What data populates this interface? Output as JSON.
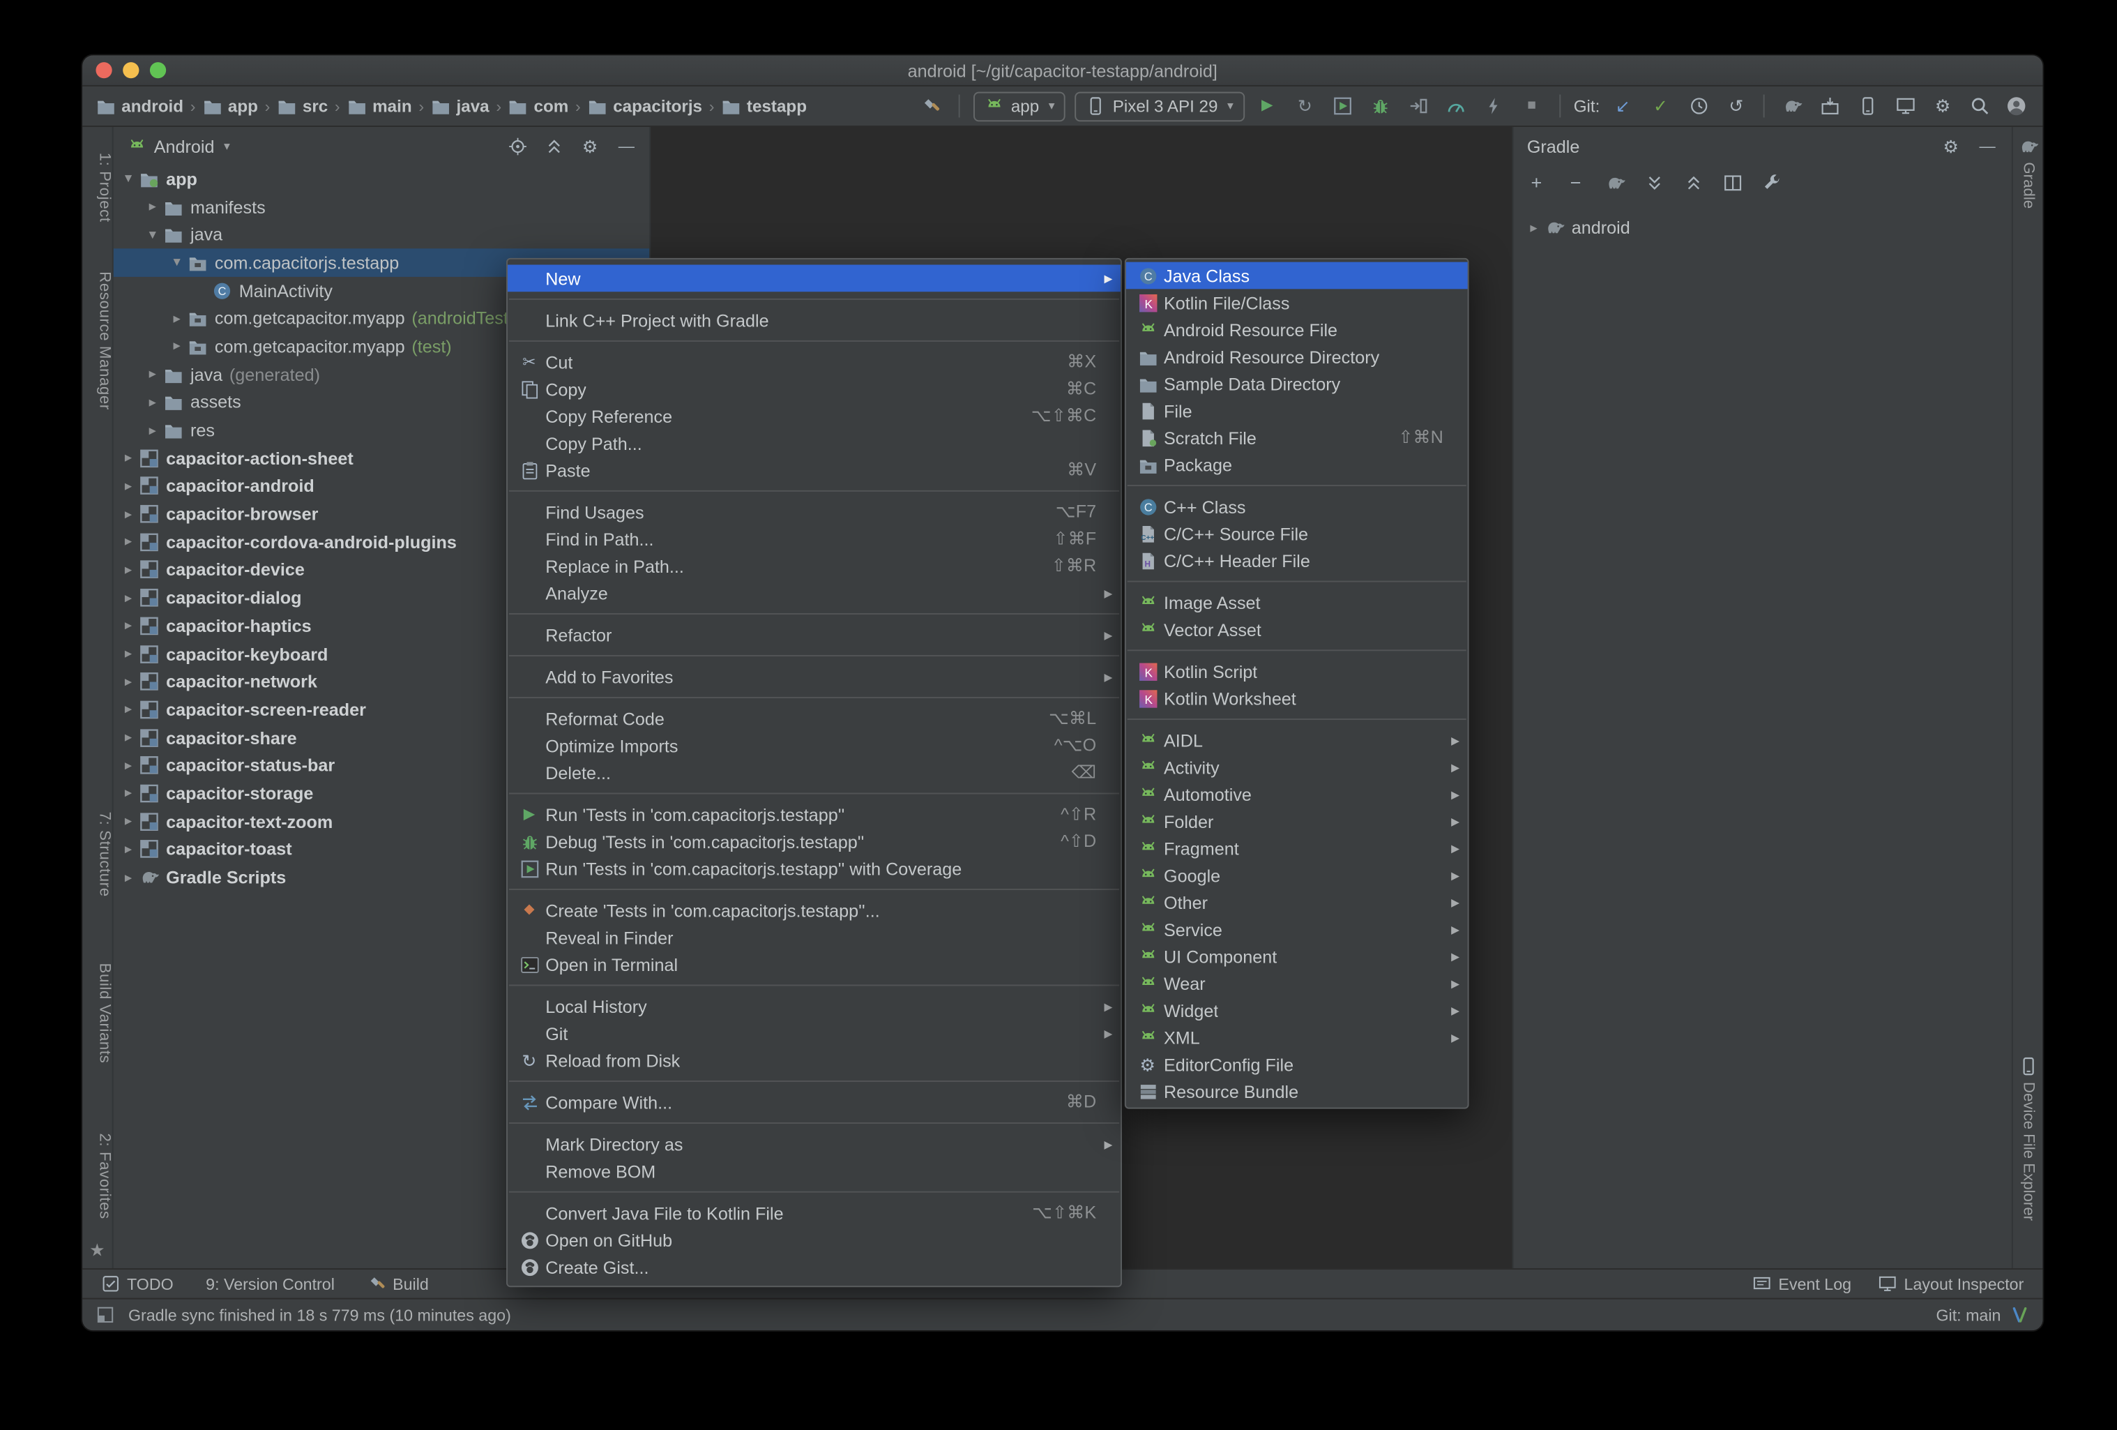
{
  "window": {
    "title": "android [~/git/capacitor-testapp/android]"
  },
  "toolbar": {
    "breadcrumbs": [
      "android",
      "app",
      "src",
      "main",
      "java",
      "com",
      "capacitorjs",
      "testapp"
    ],
    "run_config": "app",
    "device": "Pixel 3 API 29",
    "git_label": "Git:",
    "action_icons": [
      "run",
      "apply-changes",
      "coverage",
      "debug",
      "attach-debugger",
      "profiler",
      "instant-run",
      "stop"
    ],
    "git_icons": [
      "update-project",
      "commit",
      "history",
      "rollback"
    ],
    "tool_icons": [
      "gradle-sync",
      "sdk-manager",
      "avd-manager",
      "layout-inspector",
      "settings"
    ]
  },
  "left_stripe": {
    "items": [
      "1: Project",
      "Resource Manager",
      "7: Structure",
      "Build Variants",
      "2: Favorites"
    ]
  },
  "right_stripe": {
    "top": "Gradle",
    "bottom": "Device File Explorer"
  },
  "project_panel": {
    "view_selector": "Android",
    "header_icons": [
      "locate",
      "collapse-all",
      "settings",
      "hide"
    ],
    "tree": [
      {
        "label": "app",
        "icon": "app-folder",
        "level": 0,
        "chevron": "down",
        "bold": true
      },
      {
        "label": "manifests",
        "icon": "folder",
        "level": 1,
        "chevron": "right"
      },
      {
        "label": "java",
        "icon": "folder",
        "level": 1,
        "chevron": "down"
      },
      {
        "label": "com.capacitorjs.testapp",
        "icon": "package",
        "level": 2,
        "chevron": "down",
        "selected": true
      },
      {
        "label": "MainActivity",
        "icon": "class",
        "level": 3
      },
      {
        "label": "com.getcapacitor.myapp",
        "suffix": "(androidTest)",
        "suffix_type": "test",
        "icon": "package",
        "level": 2,
        "chevron": "right"
      },
      {
        "label": "com.getcapacitor.myapp",
        "suffix": "(test)",
        "suffix_type": "test",
        "icon": "package",
        "level": 2,
        "chevron": "right"
      },
      {
        "label": "java",
        "suffix": "(generated)",
        "suffix_type": "generated",
        "icon": "folder",
        "level": 1,
        "chevron": "right"
      },
      {
        "label": "assets",
        "icon": "folder",
        "level": 1,
        "chevron": "right"
      },
      {
        "label": "res",
        "icon": "folder",
        "level": 1,
        "chevron": "right"
      },
      {
        "label": "capacitor-action-sheet",
        "icon": "module",
        "level": 0,
        "chevron": "right",
        "bold": true
      },
      {
        "label": "capacitor-android",
        "icon": "module",
        "level": 0,
        "chevron": "right",
        "bold": true
      },
      {
        "label": "capacitor-browser",
        "icon": "module",
        "level": 0,
        "chevron": "right",
        "bold": true
      },
      {
        "label": "capacitor-cordova-android-plugins",
        "icon": "module",
        "level": 0,
        "chevron": "right",
        "bold": true
      },
      {
        "label": "capacitor-device",
        "icon": "module",
        "level": 0,
        "chevron": "right",
        "bold": true
      },
      {
        "label": "capacitor-dialog",
        "icon": "module",
        "level": 0,
        "chevron": "right",
        "bold": true
      },
      {
        "label": "capacitor-haptics",
        "icon": "module",
        "level": 0,
        "chevron": "right",
        "bold": true
      },
      {
        "label": "capacitor-keyboard",
        "icon": "module",
        "level": 0,
        "chevron": "right",
        "bold": true
      },
      {
        "label": "capacitor-network",
        "icon": "module",
        "level": 0,
        "chevron": "right",
        "bold": true
      },
      {
        "label": "capacitor-screen-reader",
        "icon": "module",
        "level": 0,
        "chevron": "right",
        "bold": true
      },
      {
        "label": "capacitor-share",
        "icon": "module",
        "level": 0,
        "chevron": "right",
        "bold": true
      },
      {
        "label": "capacitor-status-bar",
        "icon": "module",
        "level": 0,
        "chevron": "right",
        "bold": true
      },
      {
        "label": "capacitor-storage",
        "icon": "module",
        "level": 0,
        "chevron": "right",
        "bold": true
      },
      {
        "label": "capacitor-text-zoom",
        "icon": "module",
        "level": 0,
        "chevron": "right",
        "bold": true
      },
      {
        "label": "capacitor-toast",
        "icon": "module",
        "level": 0,
        "chevron": "right",
        "bold": true
      },
      {
        "label": "Gradle Scripts",
        "icon": "gradle",
        "level": 0,
        "chevron": "right",
        "bold": true
      }
    ]
  },
  "context_menu": {
    "groups": [
      [
        {
          "label": "New",
          "submenu": true,
          "selected": true
        }
      ],
      [
        {
          "label": "Link C++ Project with Gradle"
        }
      ],
      [
        {
          "label": "Cut",
          "icon": "cut",
          "shortcut": "⌘X"
        },
        {
          "label": "Copy",
          "icon": "copy",
          "shortcut": "⌘C"
        },
        {
          "label": "Copy Reference",
          "shortcut": "⌥⇧⌘C"
        },
        {
          "label": "Copy Path..."
        },
        {
          "label": "Paste",
          "icon": "paste",
          "shortcut": "⌘V"
        }
      ],
      [
        {
          "label": "Find Usages",
          "shortcut": "⌥F7"
        },
        {
          "label": "Find in Path...",
          "shortcut": "⇧⌘F"
        },
        {
          "label": "Replace in Path...",
          "shortcut": "⇧⌘R"
        },
        {
          "label": "Analyze",
          "submenu": true
        }
      ],
      [
        {
          "label": "Refactor",
          "submenu": true
        }
      ],
      [
        {
          "label": "Add to Favorites",
          "submenu": true
        }
      ],
      [
        {
          "label": "Reformat Code",
          "shortcut": "⌥⌘L"
        },
        {
          "label": "Optimize Imports",
          "shortcut": "^⌥O"
        },
        {
          "label": "Delete...",
          "shortcut": "⌫"
        }
      ],
      [
        {
          "label": "Run 'Tests in 'com.capacitorjs.testapp''",
          "icon": "run",
          "shortcut": "^⇧R"
        },
        {
          "label": "Debug 'Tests in 'com.capacitorjs.testapp''",
          "icon": "debug",
          "shortcut": "^⇧D"
        },
        {
          "label": "Run 'Tests in 'com.capacitorjs.testapp'' with Coverage",
          "icon": "coverage"
        }
      ],
      [
        {
          "label": "Create 'Tests in 'com.capacitorjs.testapp''...",
          "icon": "tests"
        },
        {
          "label": "Reveal in Finder"
        },
        {
          "label": "Open in Terminal",
          "icon": "terminal"
        }
      ],
      [
        {
          "label": "Local History",
          "submenu": true
        },
        {
          "label": "Git",
          "submenu": true
        },
        {
          "label": "Reload from Disk",
          "icon": "refresh"
        }
      ],
      [
        {
          "label": "Compare With...",
          "icon": "compare",
          "shortcut": "⌘D"
        }
      ],
      [
        {
          "label": "Mark Directory as",
          "submenu": true
        },
        {
          "label": "Remove BOM"
        }
      ],
      [
        {
          "label": "Convert Java File to Kotlin File",
          "shortcut": "⌥⇧⌘K"
        },
        {
          "label": "Open on GitHub",
          "icon": "github"
        },
        {
          "label": "Create Gist...",
          "icon": "github"
        }
      ]
    ]
  },
  "new_submenu": {
    "groups": [
      [
        {
          "label": "Java Class",
          "icon": "class",
          "selected": true
        },
        {
          "label": "Kotlin File/Class",
          "icon": "kotlin"
        },
        {
          "label": "Android Resource File",
          "icon": "android-file"
        },
        {
          "label": "Android Resource Directory",
          "icon": "folder"
        },
        {
          "label": "Sample Data Directory",
          "icon": "folder"
        },
        {
          "label": "File",
          "icon": "file"
        },
        {
          "label": "Scratch File",
          "icon": "scratch",
          "shortcut": "⇧⌘N"
        },
        {
          "label": "Package",
          "icon": "package"
        }
      ],
      [
        {
          "label": "C++ Class",
          "icon": "cpp-class"
        },
        {
          "label": "C/C++ Source File",
          "icon": "cpp-file"
        },
        {
          "label": "C/C++ Header File",
          "icon": "h-file"
        }
      ],
      [
        {
          "label": "Image Asset",
          "icon": "android"
        },
        {
          "label": "Vector Asset",
          "icon": "android"
        }
      ],
      [
        {
          "label": "Kotlin Script",
          "icon": "kotlin"
        },
        {
          "label": "Kotlin Worksheet",
          "icon": "kotlin"
        }
      ],
      [
        {
          "label": "AIDL",
          "icon": "android",
          "submenu": true
        },
        {
          "label": "Activity",
          "icon": "android",
          "submenu": true
        },
        {
          "label": "Automotive",
          "icon": "android",
          "submenu": true
        },
        {
          "label": "Folder",
          "icon": "android",
          "submenu": true
        },
        {
          "label": "Fragment",
          "icon": "android",
          "submenu": true
        },
        {
          "label": "Google",
          "icon": "android",
          "submenu": true
        },
        {
          "label": "Other",
          "icon": "android",
          "submenu": true
        },
        {
          "label": "Service",
          "icon": "android",
          "submenu": true
        },
        {
          "label": "UI Component",
          "icon": "android",
          "submenu": true
        },
        {
          "label": "Wear",
          "icon": "android",
          "submenu": true
        },
        {
          "label": "Widget",
          "icon": "android",
          "submenu": true
        },
        {
          "label": "XML",
          "icon": "android",
          "submenu": true
        },
        {
          "label": "EditorConfig File",
          "icon": "editorconfig"
        },
        {
          "label": "Resource Bundle",
          "icon": "bundle"
        }
      ]
    ]
  },
  "gradle_panel": {
    "title": "Gradle",
    "header_icons": [
      "settings",
      "hide"
    ],
    "toolbar_icons": [
      "add",
      "remove",
      "gradle-refresh",
      "expand-all",
      "collapse-all",
      "split",
      "wrench"
    ],
    "tree": [
      {
        "label": "android",
        "icon": "gradle",
        "chevron": "right"
      }
    ]
  },
  "navbar": {
    "left": [
      {
        "label": "TODO",
        "icon": "todo"
      },
      {
        "label": "9: Version Control"
      },
      {
        "label": "Build",
        "icon": "hammer"
      }
    ],
    "right": [
      {
        "label": "Event Log",
        "icon": "event-log"
      },
      {
        "label": "Layout Inspector",
        "icon": "layout-inspector"
      }
    ]
  },
  "statusbar": {
    "message": "Gradle sync finished in 18 s 779 ms (10 minutes ago)",
    "git_branch": "Git: main"
  },
  "theme": {
    "accent": "#3164D0",
    "tree_selection": "#2B4C6F",
    "panel_bg": "#3C3F41",
    "editor_bg": "#2B2B2B",
    "menu_bg": "#3B3E40",
    "android_green": "#77B85C",
    "run_green": "#5FA765"
  }
}
